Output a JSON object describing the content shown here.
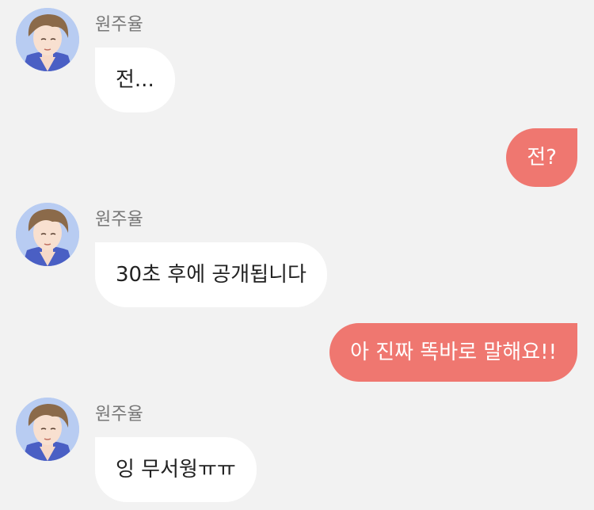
{
  "colors": {
    "background": "#f2f2f2",
    "incoming_bubble": "#ffffff",
    "outgoing_bubble": "#ef7770",
    "sender_name": "#777777"
  },
  "messages": [
    {
      "direction": "incoming",
      "sender": "원주율",
      "avatar": "avatar-icon",
      "text": "전..."
    },
    {
      "direction": "outgoing",
      "text": "전?"
    },
    {
      "direction": "incoming",
      "sender": "원주율",
      "avatar": "avatar-icon",
      "text": "30초 후에 공개됩니다"
    },
    {
      "direction": "outgoing",
      "text": "아 진짜 똑바로 말해요!!"
    },
    {
      "direction": "incoming",
      "sender": "원주율",
      "avatar": "avatar-icon",
      "text": "잉 무서웡ㅠㅠ"
    }
  ]
}
